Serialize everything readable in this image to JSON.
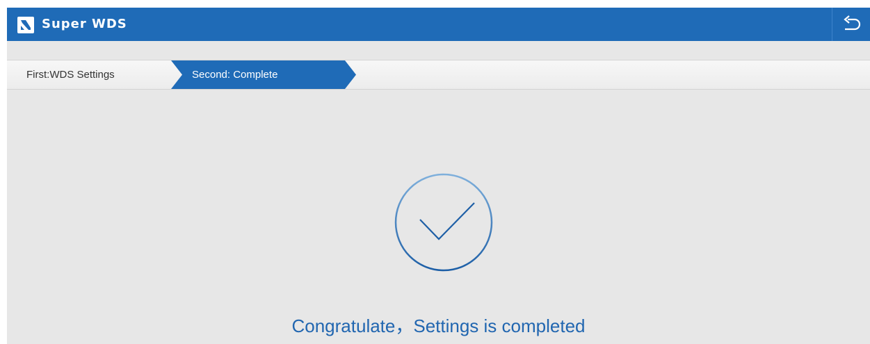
{
  "header": {
    "title": "Super WDS",
    "app_icon": "wds-logo-icon",
    "back_icon": "return-icon",
    "bg_color": "#1f6bb7"
  },
  "steps": [
    {
      "label": "First:WDS Settings",
      "active": false
    },
    {
      "label": "Second: Complete",
      "active": true
    }
  ],
  "main": {
    "status_icon": "checkmark-circle-icon",
    "message": "Congratulate，Settings is completed",
    "accent_color": "#2166b0"
  }
}
